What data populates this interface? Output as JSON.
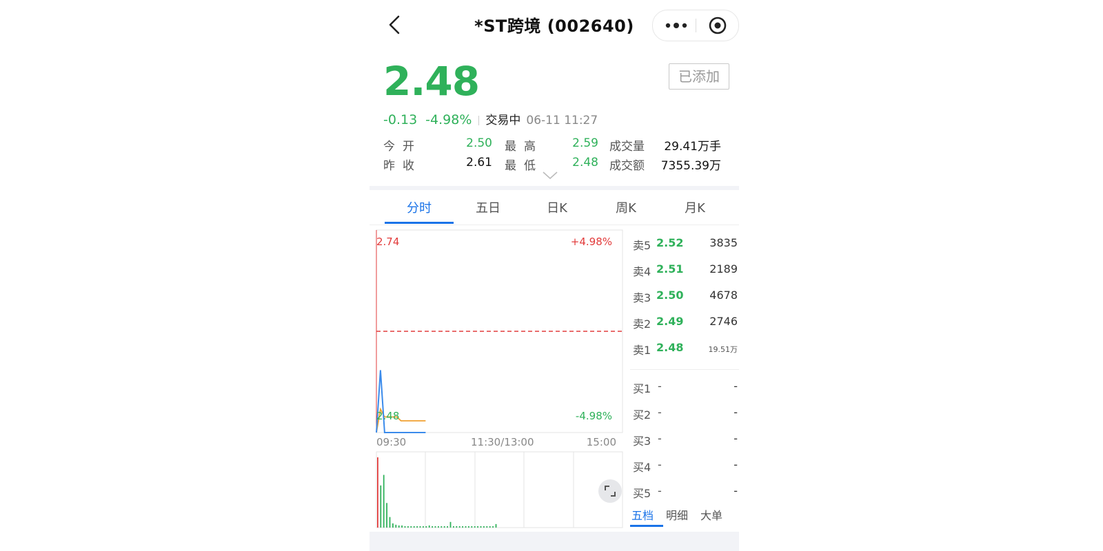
{
  "header": {
    "title": "*ST跨境 (002640)"
  },
  "quote": {
    "price": "2.48",
    "added_label": "已添加",
    "change": "-0.13",
    "change_pct": "-4.98%",
    "status": "交易中",
    "time": "06-11 11:27"
  },
  "stats": {
    "open_label": "今开",
    "open": "2.50",
    "high_label": "最高",
    "high": "2.59",
    "volume_label": "成交量",
    "volume": "29.41万手",
    "prev_close_label": "昨收",
    "prev_close": "2.61",
    "low_label": "最低",
    "low": "2.48",
    "amount_label": "成交额",
    "amount": "7355.39万"
  },
  "tabs": [
    "分时",
    "五日",
    "日K",
    "周K",
    "月K"
  ],
  "active_tab": 0,
  "chart": {
    "y_max_label": "2.74",
    "y_max_pct": "+4.98%",
    "y_min_label": "2.48",
    "y_min_pct": "-4.98%",
    "x_labels": [
      "09:30",
      "11:30/13:00",
      "15:00"
    ]
  },
  "chart_data": {
    "type": "line",
    "ylim": [
      2.48,
      2.74
    ],
    "reference": 2.61,
    "series": [
      {
        "values": [
          2.48,
          2.56,
          2.48,
          2.48,
          2.48,
          2.48,
          2.48,
          2.48,
          2.48,
          2.48,
          2.48,
          2.48,
          2.48
        ]
      },
      {
        "values": [
          2.48,
          2.51,
          2.5,
          2.5,
          2.5,
          2.5,
          2.495,
          2.495,
          2.495,
          2.495,
          2.495,
          2.495,
          2.495
        ]
      }
    ],
    "volume": [
      1.0,
      0.6,
      0.75,
      0.35,
      0.15,
      0.06,
      0.04,
      0.03,
      0.03,
      0.02,
      0.02,
      0.02,
      0.02,
      0.02,
      0.02,
      0.02,
      0.02,
      0.03,
      0.02,
      0.02,
      0.02,
      0.02,
      0.02,
      0.02,
      0.08,
      0.02,
      0.02,
      0.02,
      0.02,
      0.02,
      0.02,
      0.02,
      0.02,
      0.02,
      0.02,
      0.02,
      0.02,
      0.02,
      0.02,
      0.05
    ]
  },
  "order_book": {
    "asks": [
      {
        "label": "卖5",
        "price": "2.52",
        "vol": "3835"
      },
      {
        "label": "卖4",
        "price": "2.51",
        "vol": "2189"
      },
      {
        "label": "卖3",
        "price": "2.50",
        "vol": "4678"
      },
      {
        "label": "卖2",
        "price": "2.49",
        "vol": "2746"
      },
      {
        "label": "卖1",
        "price": "2.48",
        "vol": "19.51万"
      }
    ],
    "bids": [
      {
        "label": "买1",
        "price": "-",
        "vol": "-"
      },
      {
        "label": "买2",
        "price": "-",
        "vol": "-"
      },
      {
        "label": "买3",
        "price": "-",
        "vol": "-"
      },
      {
        "label": "买4",
        "price": "-",
        "vol": "-"
      },
      {
        "label": "买5",
        "price": "-",
        "vol": "-"
      }
    ],
    "tabs": [
      "五档",
      "明细",
      "大单"
    ]
  },
  "colors": {
    "up": "#e23b3b",
    "down": "#2fb15a",
    "accent": "#1a73e8",
    "price_line": "#3b8beb",
    "avg_line": "#f0a030"
  }
}
